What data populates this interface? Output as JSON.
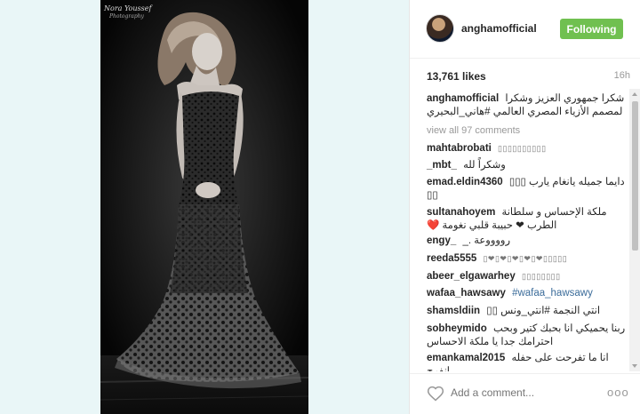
{
  "photo": {
    "watermark_line1": "Nora Youssef",
    "watermark_line2": "Photography"
  },
  "post": {
    "username": "anghamofficial",
    "follow_label": "Following",
    "likes": "13,761 likes",
    "age": "16h",
    "caption_user": "anghamofficial",
    "caption_text": "شكرا جمهوري العزيز وشكرا لمصمم الأزياء المصري العالمي #هاني_البحيري",
    "view_all": "view all 97 comments"
  },
  "comments": [
    {
      "user": "mahtabrobati",
      "text": "▯▯▯▯▯▯▯▯▯▯"
    },
    {
      "user": "_mbt_",
      "text": "وشكراً لله"
    },
    {
      "user": "emad.eldin4360",
      "text": "دايما جميله يانغام يارب ▯▯▯ ▯▯"
    },
    {
      "user": "sultanahoyem",
      "text": "ملكة الإحساس و سلطانة الطرب ❤ حبيبة قلبي نغومة ❤️"
    },
    {
      "user": "engy_",
      "text": "رووووعة ._"
    },
    {
      "user": "reeda5555",
      "text": "▯❤▯❤▯❤▯❤▯❤▯▯▯▯▯"
    },
    {
      "user": "abeer_elgawarhey",
      "text": "▯▯▯▯▯▯▯▯"
    },
    {
      "user": "wafaa_hawsawy",
      "text": "#wafaa_hawsawy"
    },
    {
      "user": "shamsldiin",
      "text": "انتي النجمة #انتي_ونس ▯▯"
    },
    {
      "user": "sobheymido",
      "text": "ربنا يحميكي انا بحبك كتير وبحب احترامك جدا يا ملكة الاحساس"
    },
    {
      "user": "emankamal2015",
      "text": "انا ما تفرحت على حفله انفرح"
    }
  ],
  "footer": {
    "add_comment_placeholder": "Add a comment...",
    "more_label": "ooo"
  },
  "colors": {
    "follow_button": "#70c050",
    "hashtag": "#3b6c9a",
    "page_background": "#e9f6f7"
  }
}
